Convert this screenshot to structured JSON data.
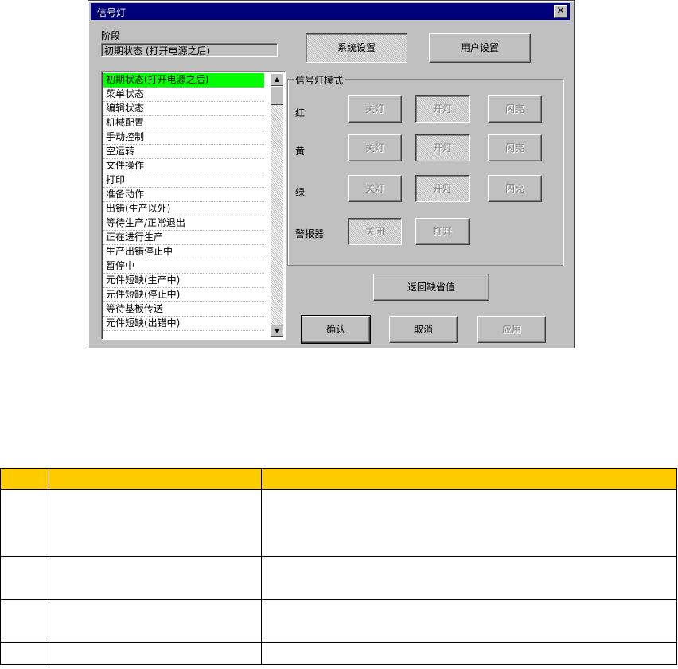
{
  "window": {
    "title": "信号灯"
  },
  "stage": {
    "label": "阶段",
    "value": "初期状态 (打开电源之后)"
  },
  "tabs": {
    "system": "系统设置",
    "user": "用户设置"
  },
  "states": [
    "初期状态(打开电源之后)",
    "菜单状态",
    "编辑状态",
    "机械配置",
    "手动控制",
    "空运转",
    "文件操作",
    "打印",
    "准备动作",
    "出错(生产以外)",
    "等待生产/正常退出",
    "正在进行生产",
    "生产出错停止中",
    "暂停中",
    "元件短缺(生产中)",
    "元件短缺(停止中)",
    "等待基板传送",
    "元件短缺(出错中)"
  ],
  "mode_group": {
    "title": "信号灯模式",
    "rows": [
      {
        "label": "红",
        "off": "关灯",
        "on": "开灯",
        "blink": "闪亮"
      },
      {
        "label": "黄",
        "off": "关灯",
        "on": "开灯",
        "blink": "闪亮"
      },
      {
        "label": "绿",
        "off": "关灯",
        "on": "开灯",
        "blink": "闪亮"
      }
    ],
    "alarm": {
      "label": "警报器",
      "off": "关闭",
      "on": "打开"
    }
  },
  "buttons": {
    "restore_default": "返回缺省值",
    "ok": "确认",
    "cancel": "取消",
    "apply": "应用"
  },
  "colors": {
    "titlebar": "#00007b",
    "selection": "#00ff00",
    "dialog_bg": "#c0c0c0",
    "table_header": "#ffcc00"
  }
}
